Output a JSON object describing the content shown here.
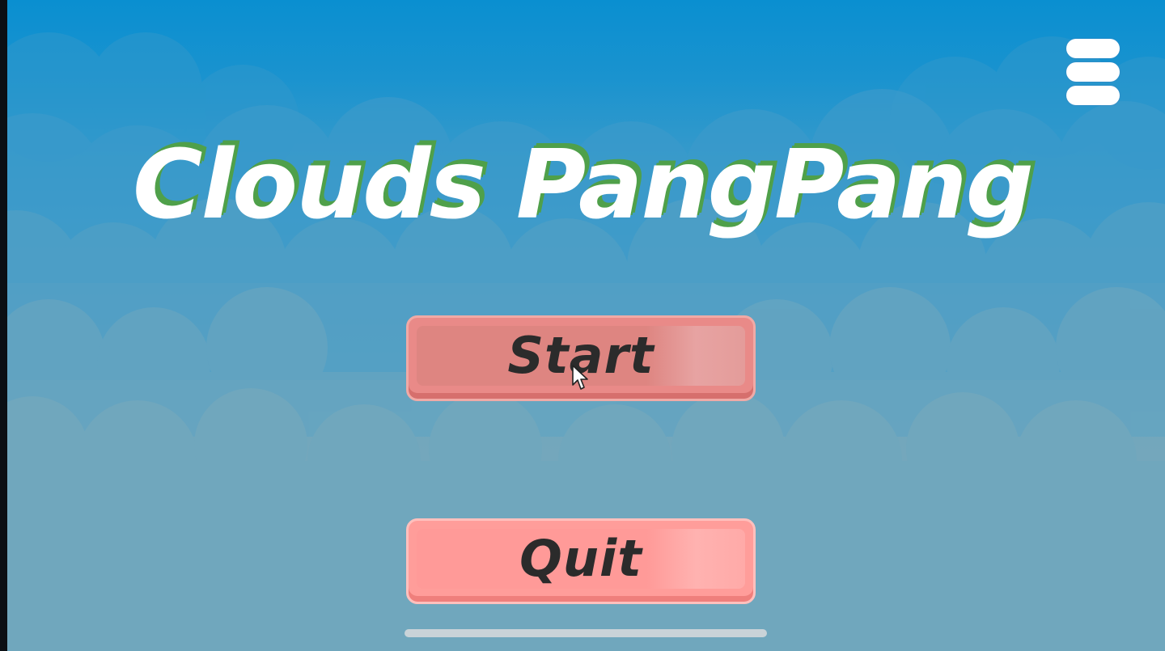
{
  "game": {
    "title": "Clouds PangPang"
  },
  "menu": {
    "icon": "hamburger-menu-icon"
  },
  "buttons": {
    "start_label": "Start",
    "quit_label": "Quit"
  },
  "colors": {
    "sky_top": "#0a8fd0",
    "sky_bottom": "#7aa8bb",
    "title_text": "#ffffff",
    "title_shadow": "#4fa04a",
    "start_button": "#e98a88",
    "quit_button": "#ff9d9a",
    "button_text": "#2b2b2b"
  }
}
